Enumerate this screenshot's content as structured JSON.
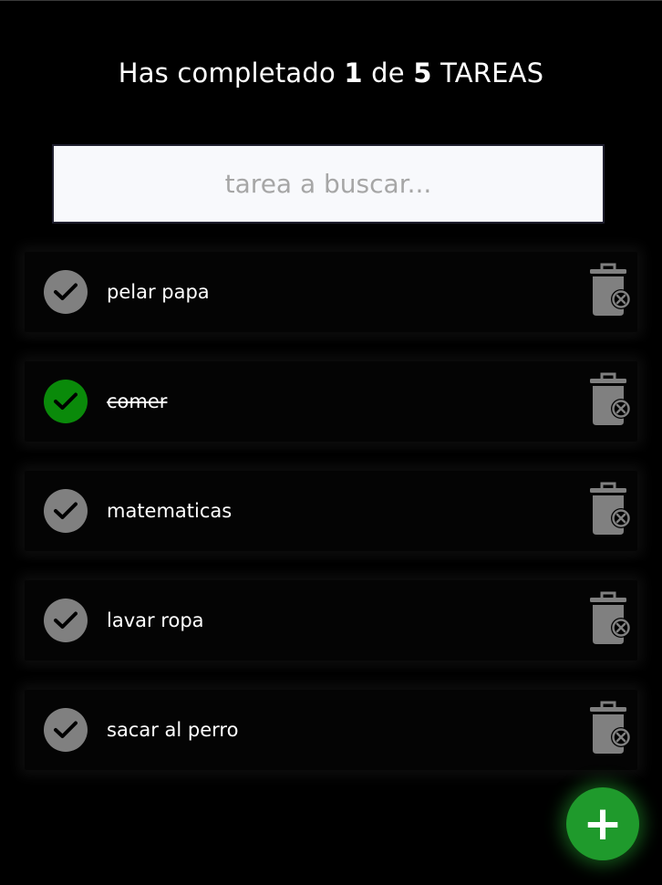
{
  "header": {
    "prefix": "Has completado",
    "completed": "1",
    "middle": "de",
    "total": "5",
    "suffix": "TAREAS"
  },
  "search": {
    "placeholder": "tarea a buscar...",
    "value": ""
  },
  "todos": [
    {
      "text": "pelar papa",
      "completed": false
    },
    {
      "text": "comer",
      "completed": true
    },
    {
      "text": "matematicas",
      "completed": false
    },
    {
      "text": "lavar ropa",
      "completed": false
    },
    {
      "text": "sacar al perro",
      "completed": false
    }
  ],
  "icons": {
    "check": "check-icon",
    "delete": "trash-delete-icon",
    "add": "plus-icon"
  },
  "add_button": {
    "label": "+"
  },
  "colors": {
    "background": "#000000",
    "check_pending": "#808080",
    "check_done": "#0a8a0a",
    "trash": "#808080",
    "add_button": "#1f9a2c",
    "search_bg": "#f8f9fc"
  }
}
